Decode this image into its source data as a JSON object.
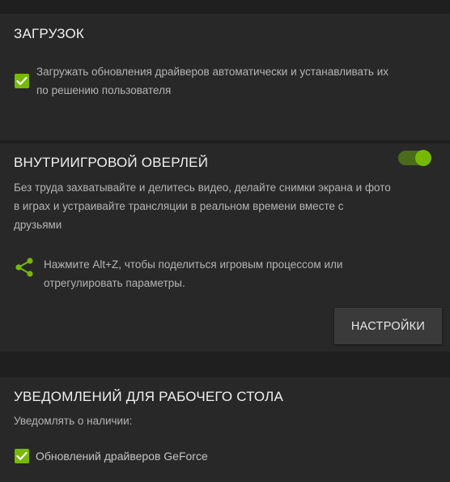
{
  "colors": {
    "accent": "#76b900",
    "panel_bg": "#282828",
    "page_bg": "#1f1f1f",
    "button_bg": "#3a3a3a"
  },
  "download": {
    "title": "ЗАГРУЗОК",
    "auto_update": {
      "checked": true,
      "label_line1": "Загружать обновления драйверов автоматически и устанавливать их",
      "label_line2": "по решению пользователя"
    }
  },
  "overlay": {
    "title": "ВНУТРИИГРОВОЙ ОВЕРЛЕЙ",
    "toggle_on": true,
    "description_line1": "Без труда захватывайте и делитесь видео, делайте снимки экрана и фото",
    "description_line2": "в играх и устраивайте трансляции в реальном времени вместе с",
    "description_line3": "друзьями",
    "tip_icon": "share-icon",
    "tip_line1": "Нажмите Alt+Z, чтобы поделиться игровым процессом или",
    "tip_line2": "отрегулировать параметры.",
    "settings_label": "НАСТРОЙКИ"
  },
  "notifications": {
    "title": "УВЕДОМЛЕНИЙ ДЛЯ РАБОЧЕГО СТОЛА",
    "subtitle": "Уведомлять о наличии:",
    "driver_updates": {
      "checked": true,
      "label": "Обновлений драйверов GeForce"
    }
  }
}
